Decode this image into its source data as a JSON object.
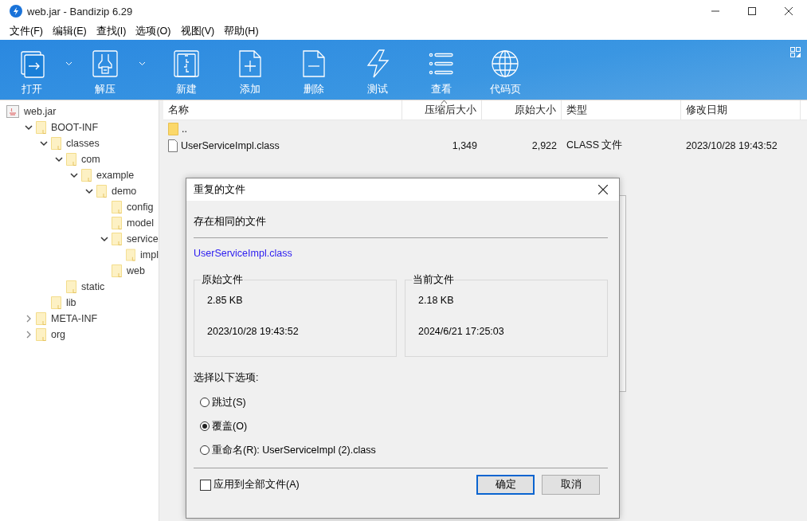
{
  "window": {
    "title": "web.jar - Bandizip 6.29"
  },
  "menu": [
    "文件(F)",
    "编辑(E)",
    "查找(I)",
    "选项(O)",
    "视图(V)",
    "帮助(H)"
  ],
  "toolbar": [
    {
      "label": "打开",
      "dropdown": true
    },
    {
      "label": "解压",
      "dropdown": true
    },
    {
      "label": "新建",
      "dropdown": false
    },
    {
      "label": "添加",
      "dropdown": false
    },
    {
      "label": "删除",
      "dropdown": false
    },
    {
      "label": "测试",
      "dropdown": false
    },
    {
      "label": "查看",
      "dropdown": false
    },
    {
      "label": "代码页",
      "dropdown": false
    }
  ],
  "tree": {
    "label": "web.jar",
    "children": [
      {
        "label": "BOOT-INF",
        "expanded": true,
        "children": [
          {
            "label": "classes",
            "expanded": true,
            "children": [
              {
                "label": "com",
                "expanded": true,
                "children": [
                  {
                    "label": "example",
                    "expanded": true,
                    "children": [
                      {
                        "label": "demo",
                        "expanded": true,
                        "children": [
                          {
                            "label": "config"
                          },
                          {
                            "label": "model"
                          },
                          {
                            "label": "service",
                            "expanded": true,
                            "children": [
                              {
                                "label": "impl"
                              }
                            ]
                          },
                          {
                            "label": "web"
                          }
                        ]
                      }
                    ]
                  }
                ]
              },
              {
                "label": "static"
              }
            ]
          },
          {
            "label": "lib"
          }
        ]
      },
      {
        "label": "META-INF",
        "expanded": false
      },
      {
        "label": "org",
        "expanded": false
      }
    ]
  },
  "table": {
    "columns": [
      {
        "label": "名称",
        "sorted": false
      },
      {
        "label": "压缩后大小",
        "sorted": true
      },
      {
        "label": "原始大小",
        "sorted": false
      },
      {
        "label": "类型",
        "sorted": false
      },
      {
        "label": "修改日期",
        "sorted": false
      }
    ],
    "rows": [
      {
        "kind": "folder",
        "cells": [
          "..",
          "",
          "",
          "",
          ""
        ]
      },
      {
        "kind": "file",
        "cells": [
          "UserServiceImpl.class",
          "1,349",
          "2,922",
          "CLASS 文件",
          "2023/10/28 19:43:52"
        ]
      }
    ]
  },
  "dialog": {
    "title": "重复的文件",
    "heading": "存在相同的文件",
    "filename": "UserServiceImpl.class",
    "groups": [
      {
        "legend": "原始文件",
        "size": "2.85 KB",
        "date": "2023/10/28 19:43:52"
      },
      {
        "legend": "当前文件",
        "size": "2.18 KB",
        "date": "2024/6/21 17:25:03"
      }
    ],
    "prompt": "选择以下选项:",
    "options": [
      {
        "label": "跳过(S)",
        "selected": false
      },
      {
        "label": "覆盖(O)",
        "selected": true
      },
      {
        "label": "重命名(R): UserServiceImpl (2).class",
        "selected": false
      }
    ],
    "apply_all": {
      "label": "应用到全部文件(A)",
      "checked": false
    },
    "buttons": [
      {
        "label": "确定",
        "default": true
      },
      {
        "label": "取消",
        "default": false
      }
    ]
  }
}
